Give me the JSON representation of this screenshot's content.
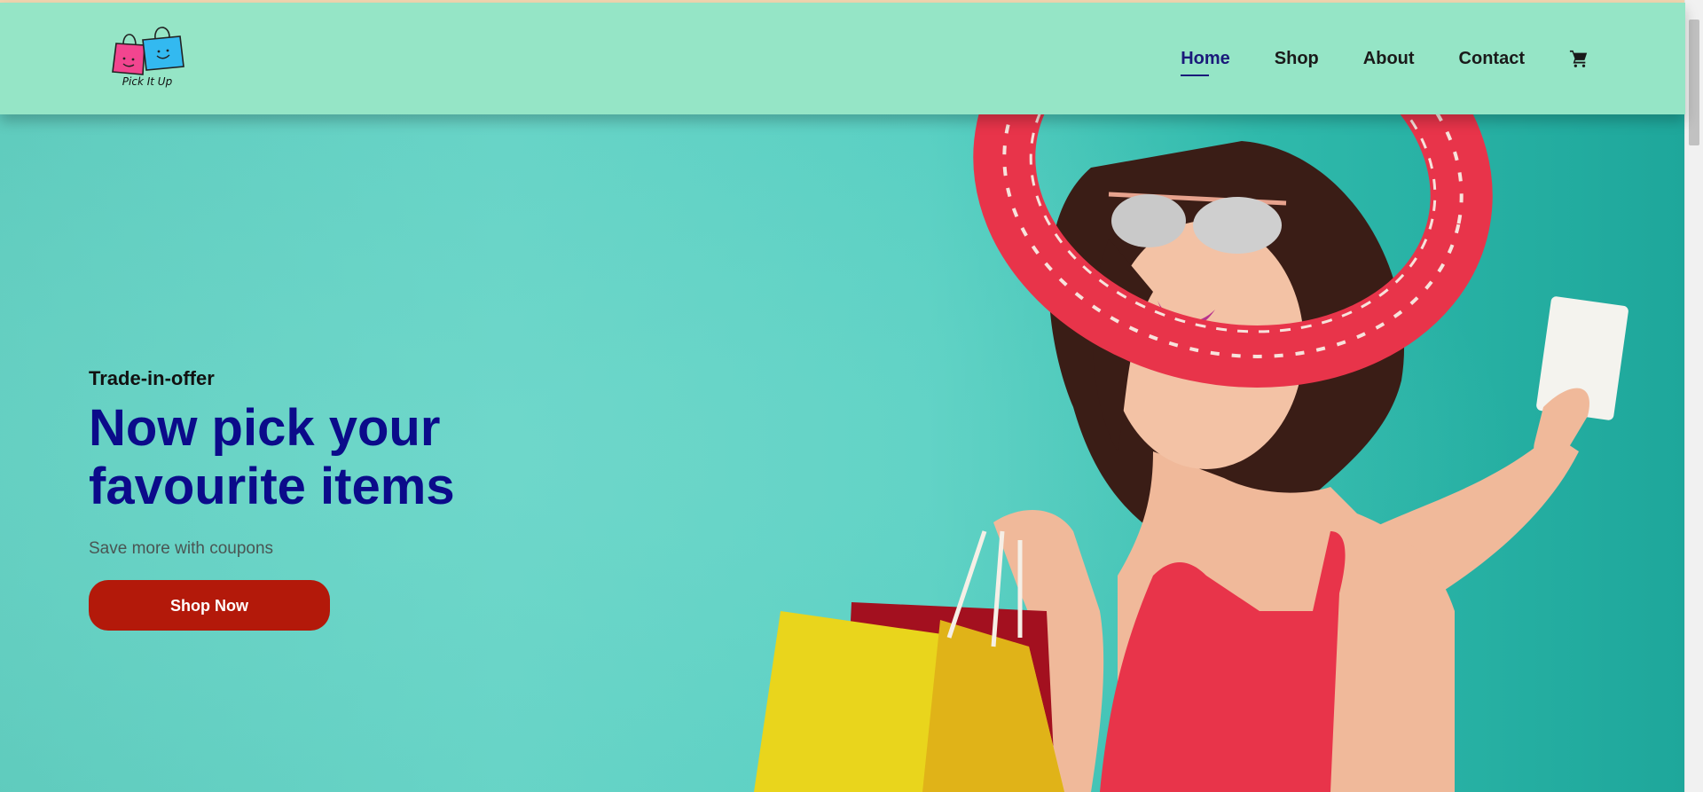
{
  "brand": {
    "name": "Pick It Up"
  },
  "nav": {
    "items": [
      {
        "label": "Home",
        "active": true
      },
      {
        "label": "Shop",
        "active": false
      },
      {
        "label": "About",
        "active": false
      },
      {
        "label": "Contact",
        "active": false
      }
    ],
    "cart_icon": "shopping-cart-icon"
  },
  "hero": {
    "eyebrow": "Trade-in-offer",
    "headline_line1": "Now pick your",
    "headline_line2": "favourite items",
    "subtitle": "Save more with coupons",
    "cta_label": "Shop Now"
  },
  "colors": {
    "header_bg": "#95e5c6",
    "hero_bg": "#5fcbbd",
    "headline": "#0b0b8a",
    "cta_bg": "#b3190a",
    "nav_active": "#1a1a7a"
  }
}
